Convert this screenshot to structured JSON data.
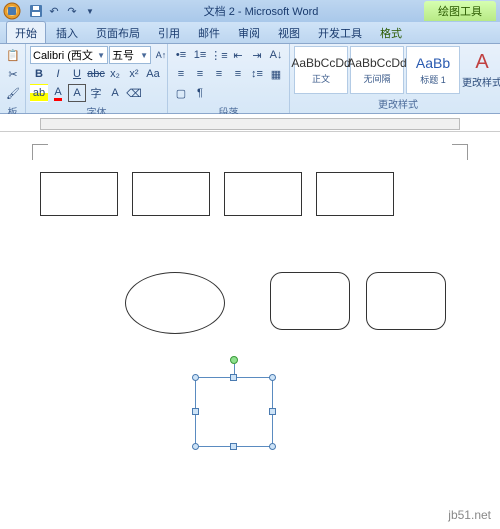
{
  "title": "文档 2 - Microsoft Word",
  "contextTab": "绘图工具",
  "tabs": {
    "start": "开始",
    "insert": "插入",
    "layout": "页面布局",
    "ref": "引用",
    "mail": "邮件",
    "review": "审阅",
    "view": "视图",
    "dev": "开发工具",
    "format": "格式"
  },
  "font": {
    "name": "Calibri (西文",
    "size": "五号"
  },
  "groups": {
    "clipboard": "板",
    "font": "字体",
    "para": "段落",
    "styles": "更改样式"
  },
  "styles": {
    "preview": "AaBbCcDd",
    "previewH": "AaBb",
    "normal": "正文",
    "nospace": "无间隔",
    "h1": "标题 1",
    "change": "更改样式"
  },
  "watermark": "jb51.net"
}
